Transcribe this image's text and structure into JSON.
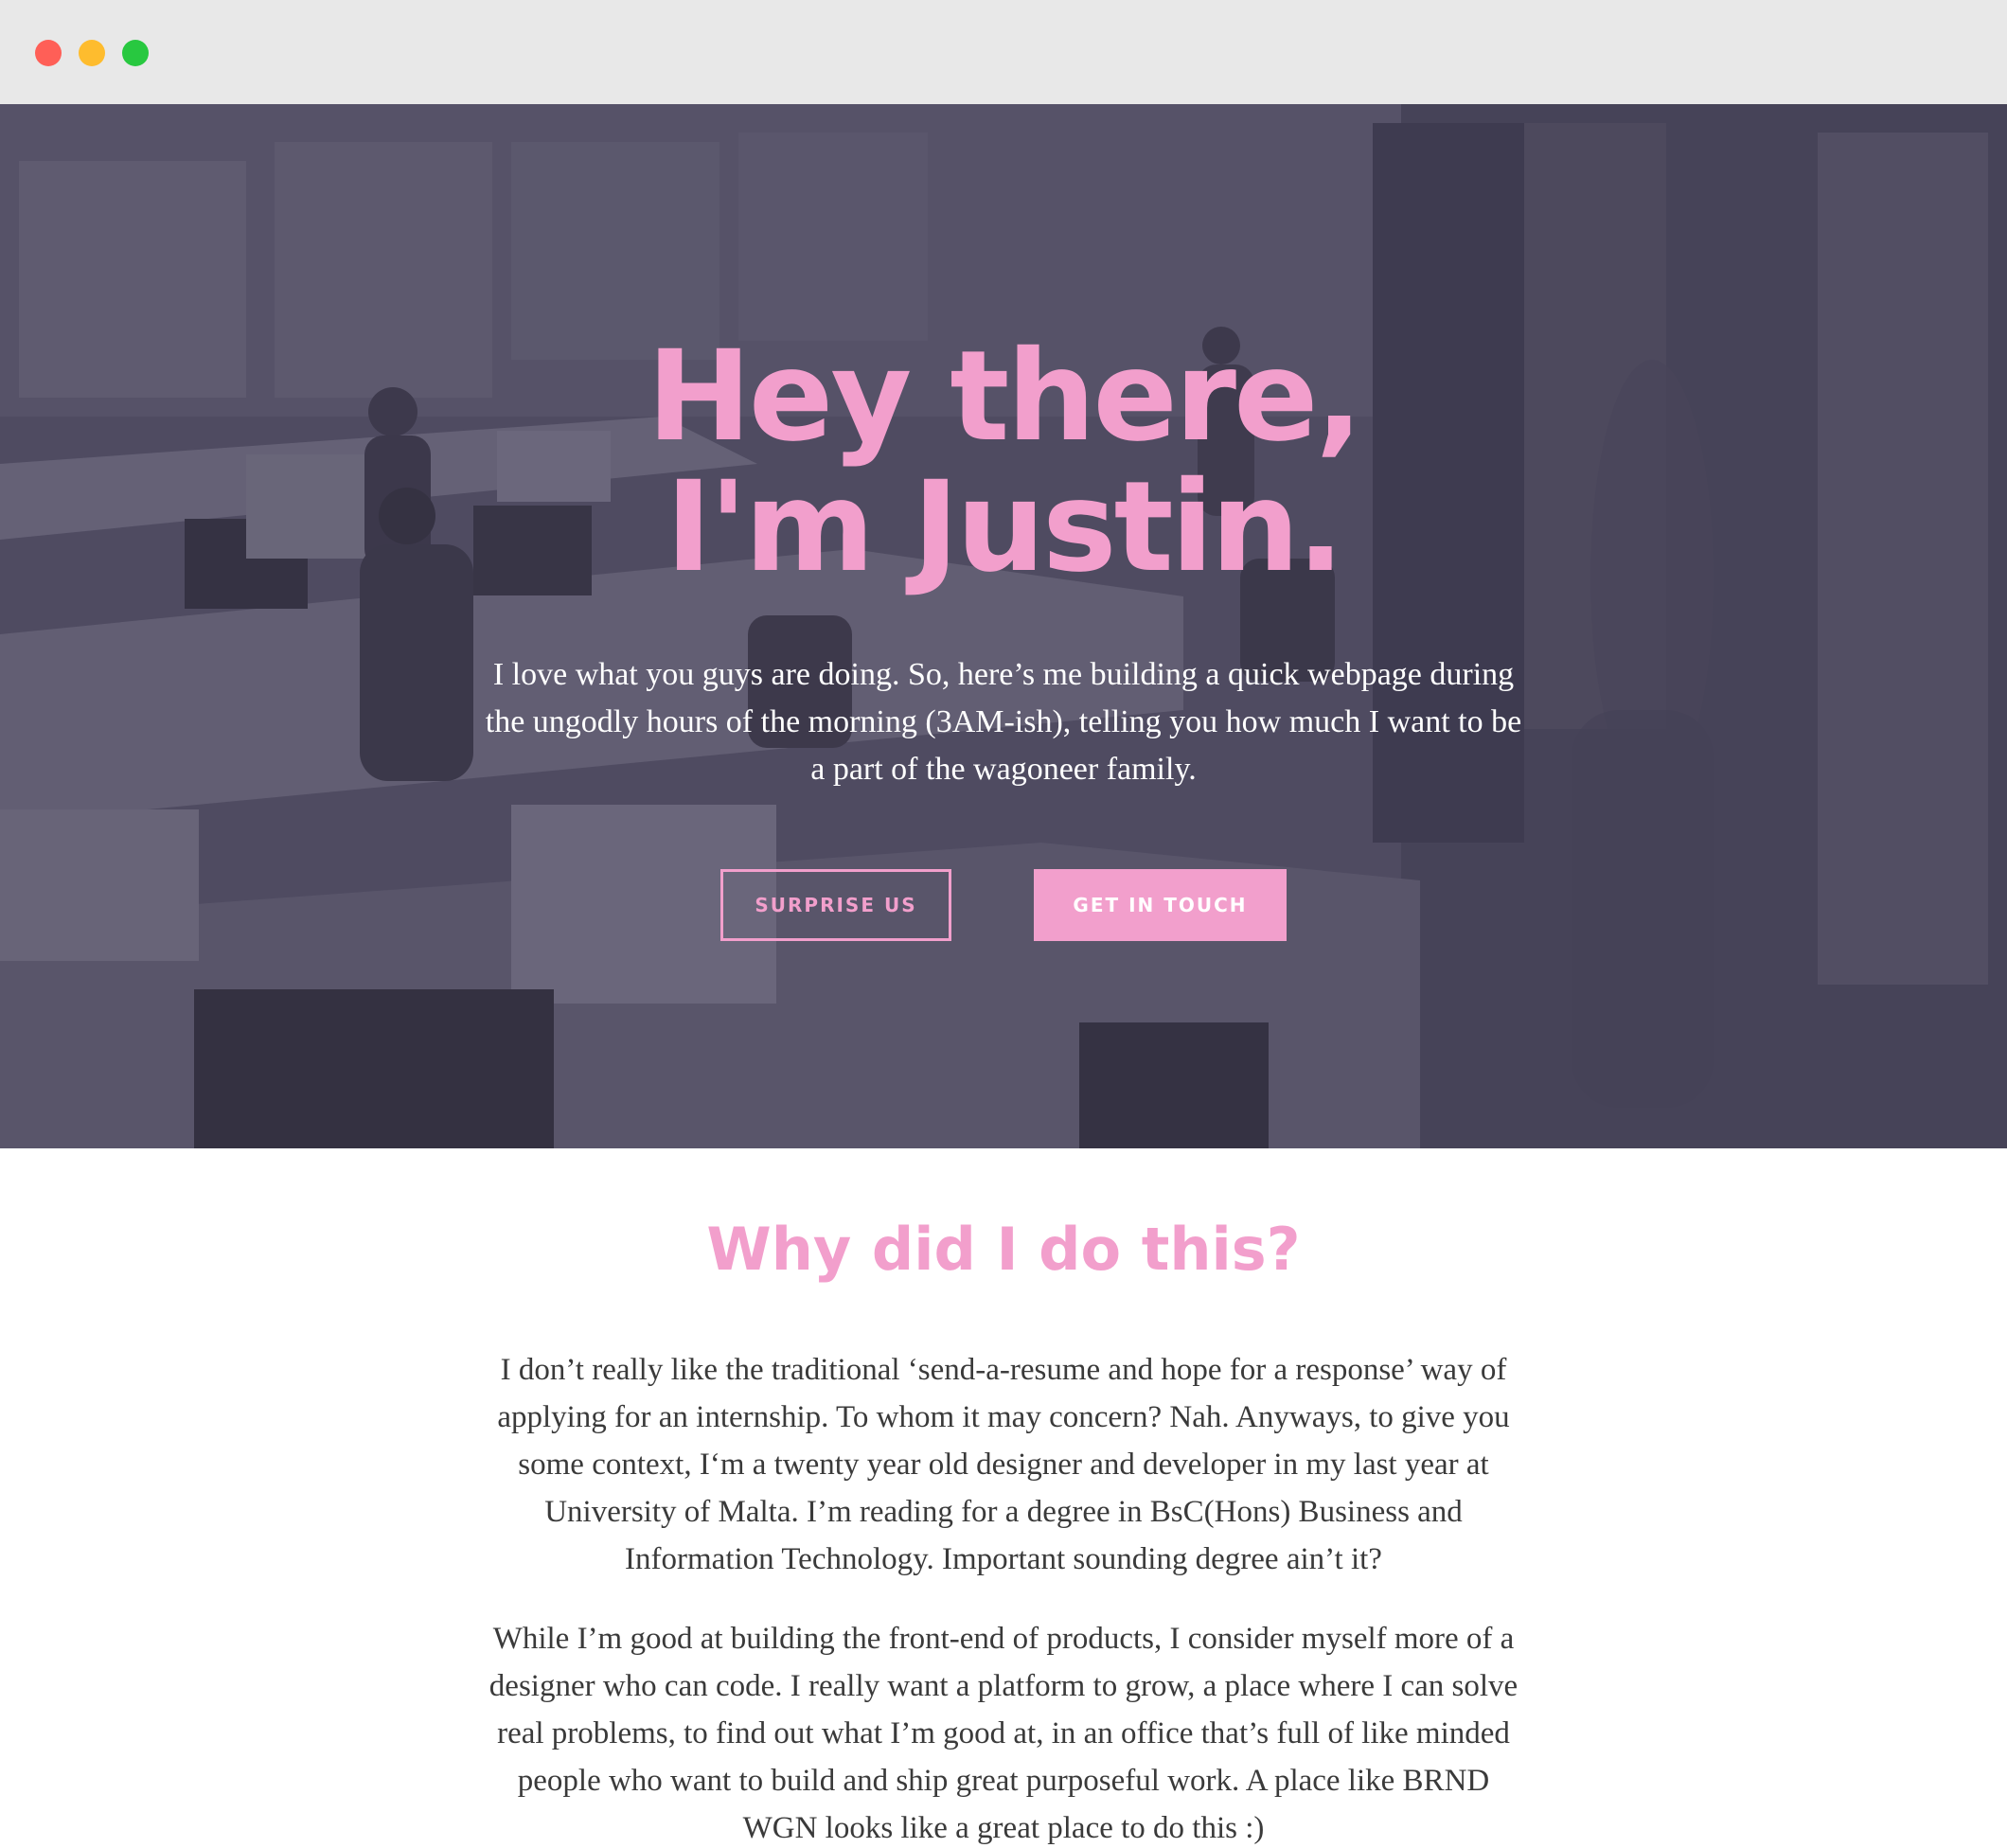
{
  "hero": {
    "title_line1": "Hey there,",
    "title_line2": "I'm Justin.",
    "subtitle": "I love what you guys are doing. So, here’s me building a quick webpage during the ungodly hours of the morning (3AM-ish), telling you how much I want to be a part of the wagoneer family.",
    "buttons": {
      "surprise_label": "SURPRISE US",
      "contact_label": "GET IN TOUCH"
    }
  },
  "why": {
    "heading": "Why did I do this?",
    "paragraph_1": "I don’t really like the traditional ‘send-a-resume and hope for a response’ way of applying for an internship. To whom it may concern? Nah. Anyways, to give you some context, I‘m a twenty year old designer and developer in my last year at University of Malta. I’m reading for a degree in BsC(Hons) Business and Information Technology. Important sounding degree ain’t it?",
    "paragraph_2": "While I’m good at building the front-end of products, I consider myself more of a designer who can code. I really want a platform to grow, a place where I can solve real problems, to find out what I’m good at, in an office that’s full of like minded people who want to build and ship great purposeful work. A place like BRND WGN looks like a great place to do this :)"
  },
  "colors": {
    "accent": "#f29fcc",
    "hero_tint": "#55526a",
    "body_text": "#3a3a3a",
    "titlebar": "#e8e8e8"
  }
}
